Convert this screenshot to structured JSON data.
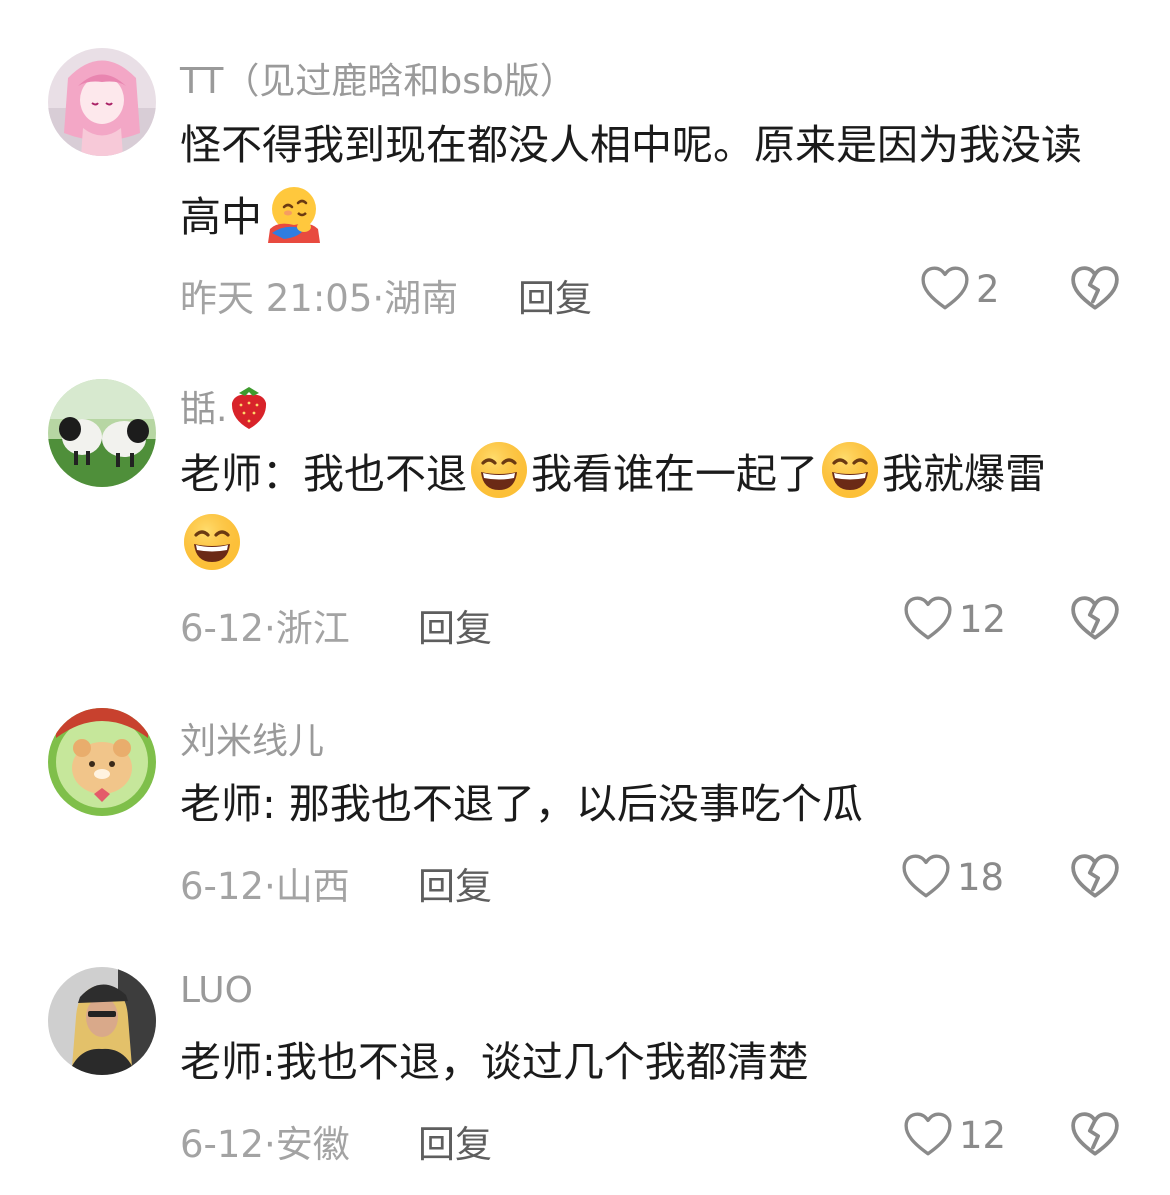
{
  "comments": [
    {
      "username": "TT（见过鹿晗和bsb版）",
      "text_parts": [
        "怪不得我到现在都没人相中呢。原来是因为我没读高中"
      ],
      "emoji_names": [
        "hugging-emoji"
      ],
      "timestamp": "昨天 21:05",
      "location": "湖南",
      "reply_label": "回复",
      "likes": "2"
    },
    {
      "username": "甛.",
      "username_emoji": "strawberry-emoji",
      "text_parts": [
        "老师：我也不退",
        "我看谁在一起了",
        "我就爆雷"
      ],
      "emoji_names": [
        "grinning-emoji",
        "grinning-emoji",
        "grinning-emoji"
      ],
      "timestamp": "6-12",
      "location": "浙江",
      "reply_label": "回复",
      "likes": "12"
    },
    {
      "username": "刘米线儿",
      "text_parts": [
        "老师: 那我也不退了，以后没事吃个瓜"
      ],
      "timestamp": "6-12",
      "location": "山西",
      "reply_label": "回复",
      "likes": "18"
    },
    {
      "username": "LUO",
      "text_parts": [
        "老师:我也不退，谈过几个我都清楚"
      ],
      "timestamp": "6-12",
      "location": "安徽",
      "reply_label": "回复",
      "likes": "12"
    }
  ],
  "separator": "·",
  "colors": {
    "username": "#9a9a9a",
    "text": "#1b1b1b",
    "meta": "#a3a3a3",
    "reply": "#5e5e5e"
  }
}
